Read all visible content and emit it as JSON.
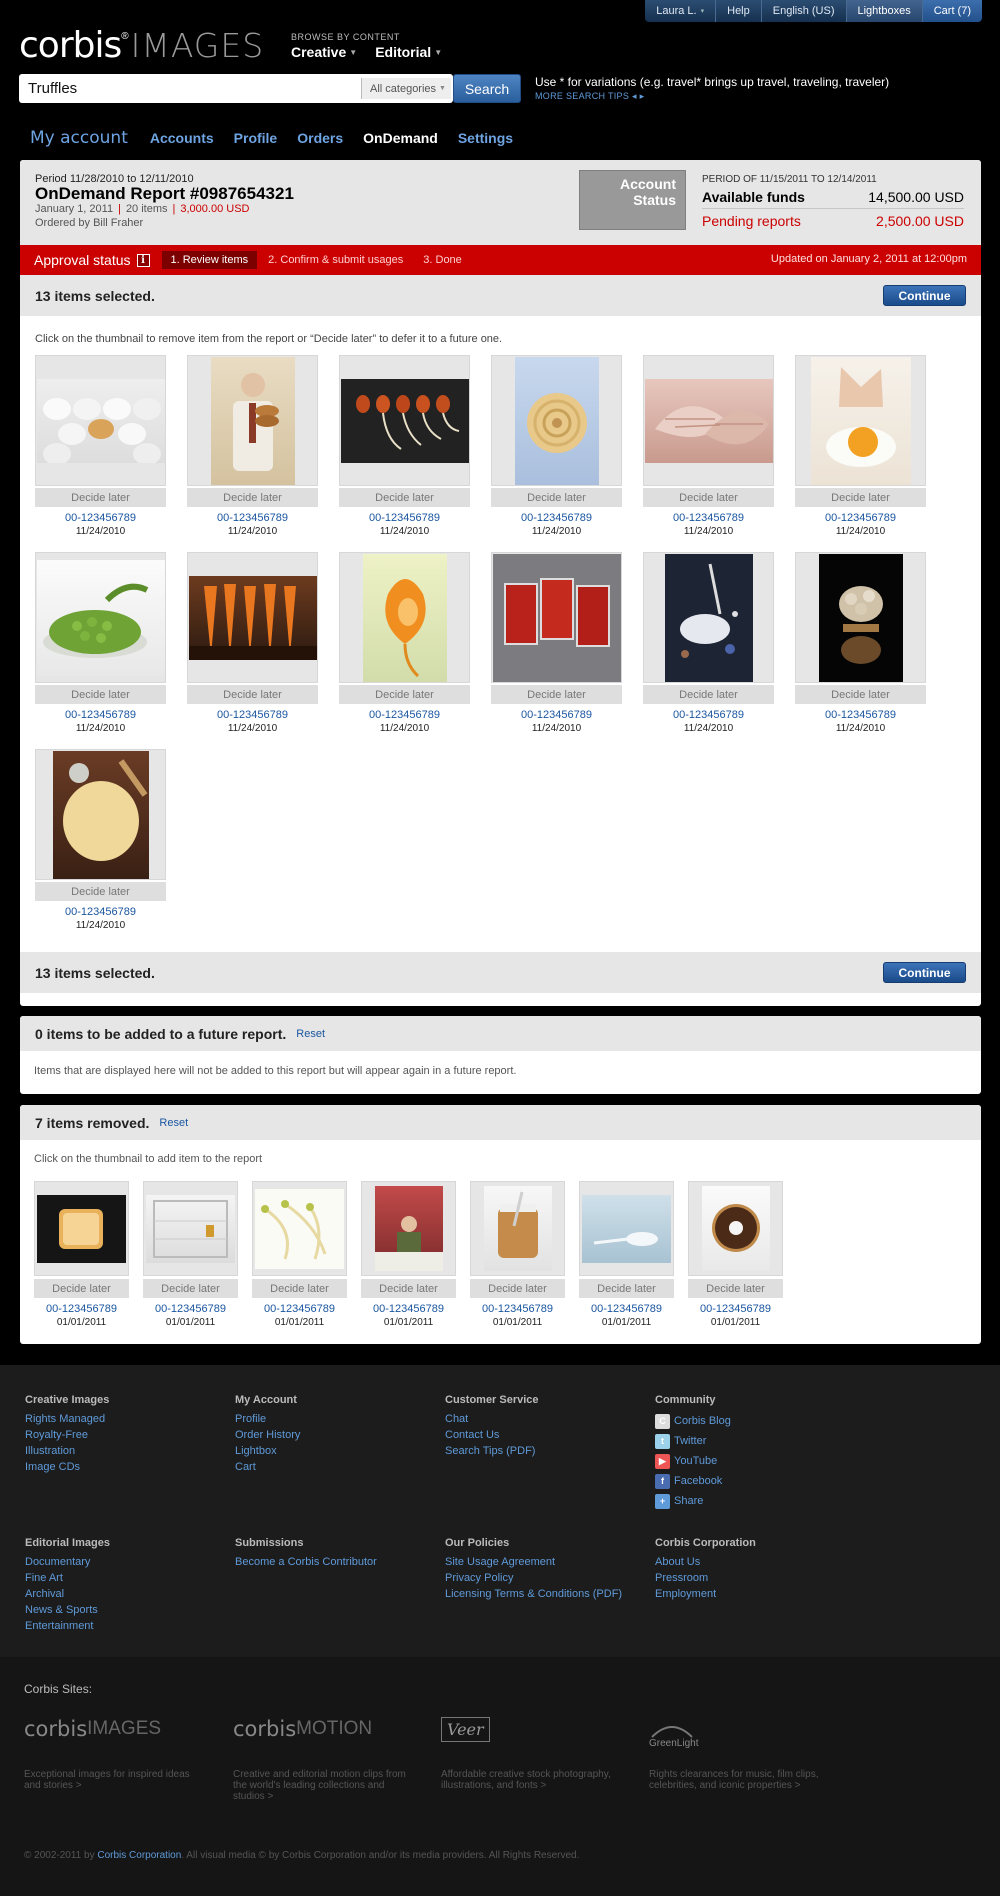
{
  "topbar": {
    "user": "Laura L.",
    "help": "Help",
    "language": "English (US)",
    "lightboxes": "Lightboxes",
    "cart": "Cart (7)"
  },
  "logo": {
    "brand": "corbis",
    "reg": "®",
    "images": "IMAGES"
  },
  "browse": {
    "caption": "BROWSE BY CONTENT",
    "creative": "Creative",
    "editorial": "Editorial"
  },
  "search": {
    "value": "Truffles",
    "category": "All categories",
    "button": "Search",
    "tip": "Use * for variations (e.g. travel* brings up travel, traveling, traveler)",
    "more_tips": "MORE SEARCH TIPS ◂ ▸"
  },
  "subnav": {
    "title": "My account",
    "tabs": [
      "Accounts",
      "Profile",
      "Orders",
      "OnDemand",
      "Settings"
    ]
  },
  "report": {
    "period": "Period 11/28/2010 to 12/11/2010",
    "title": "OnDemand Report #0987654321",
    "date": "January 1, 2011",
    "items": "20 items",
    "amount": "3,000.00 USD",
    "ordered_by": "Ordered by Bill Fraher",
    "account_status": "Account Status",
    "funds_period": "PERIOD OF 11/15/2011 TO 12/14/2011",
    "available_label": "Available funds",
    "available_value": "14,500.00 USD",
    "pending_label": "Pending reports",
    "pending_value": "2,500.00 USD"
  },
  "approval": {
    "label": "Approval status",
    "info": "i",
    "steps": [
      "1. Review items",
      "2. Confirm & submit usages",
      "3. Done"
    ],
    "updated": "Updated on January 2, 2011 at 12:00pm"
  },
  "selection": {
    "count": "13 items selected.",
    "continue": "Continue",
    "instruction": "Click on the thumbnail to remove item from the report or “Decide later” to defer it to a future one."
  },
  "items": [
    {
      "decide": "Decide later",
      "id": "00-123456789",
      "date": "11/24/2010",
      "subject": "eggs"
    },
    {
      "decide": "Decide later",
      "id": "00-123456789",
      "date": "11/24/2010",
      "subject": "man-with-bread"
    },
    {
      "decide": "Decide later",
      "id": "00-123456789",
      "date": "11/24/2010",
      "subject": "sprouts"
    },
    {
      "decide": "Decide later",
      "id": "00-123456789",
      "date": "11/24/2010",
      "subject": "pasta-nest"
    },
    {
      "decide": "Decide later",
      "id": "00-123456789",
      "date": "11/24/2010",
      "subject": "mushrooms"
    },
    {
      "decide": "Decide later",
      "id": "00-123456789",
      "date": "11/24/2010",
      "subject": "egg-yolk"
    },
    {
      "decide": "Decide later",
      "id": "00-123456789",
      "date": "11/24/2010",
      "subject": "peas"
    },
    {
      "decide": "Decide later",
      "id": "00-123456789",
      "date": "11/24/2010",
      "subject": "carrots"
    },
    {
      "decide": "Decide later",
      "id": "00-123456789",
      "date": "11/24/2010",
      "subject": "orange-peel"
    },
    {
      "decide": "Decide later",
      "id": "00-123456789",
      "date": "11/24/2010",
      "subject": "chili-packets"
    },
    {
      "decide": "Decide later",
      "id": "00-123456789",
      "date": "11/24/2010",
      "subject": "salt-crystals"
    },
    {
      "decide": "Decide later",
      "id": "00-123456789",
      "date": "11/24/2010",
      "subject": "mushroom-stack"
    },
    {
      "decide": "Decide later",
      "id": "00-123456789",
      "date": "11/24/2010",
      "subject": "dough"
    }
  ],
  "future": {
    "title": "0 items to be added to a future report.",
    "reset": "Reset",
    "note": "Items that are displayed here will not be added to this report but will appear again in a future report."
  },
  "removed": {
    "title": "7 items removed.",
    "reset": "Reset",
    "instruction": "Click on the thumbnail to add item to the report",
    "items": [
      {
        "decide": "Decide later",
        "id": "00-123456789",
        "date": "01/01/2011",
        "subject": "toast"
      },
      {
        "decide": "Decide later",
        "id": "00-123456789",
        "date": "01/01/2011",
        "subject": "fridge"
      },
      {
        "decide": "Decide later",
        "id": "00-123456789",
        "date": "01/01/2011",
        "subject": "sprouts"
      },
      {
        "decide": "Decide later",
        "id": "00-123456789",
        "date": "01/01/2011",
        "subject": "dining-person"
      },
      {
        "decide": "Decide later",
        "id": "00-123456789",
        "date": "01/01/2011",
        "subject": "peanut-butter"
      },
      {
        "decide": "Decide later",
        "id": "00-123456789",
        "date": "01/01/2011",
        "subject": "spoon"
      },
      {
        "decide": "Decide later",
        "id": "00-123456789",
        "date": "01/01/2011",
        "subject": "donut"
      }
    ]
  },
  "footer": {
    "creative": {
      "title": "Creative Images",
      "links": [
        "Rights Managed",
        "Royalty-Free",
        "Illustration",
        "Image CDs"
      ]
    },
    "account": {
      "title": "My Account",
      "links": [
        "Profile",
        "Order History",
        "Lightbox",
        "Cart"
      ]
    },
    "service": {
      "title": "Customer Service",
      "links": [
        "Chat",
        "Contact Us",
        "Search Tips (PDF)"
      ]
    },
    "community": {
      "title": "Community",
      "links": [
        "Corbis Blog",
        "Twitter",
        "YouTube",
        "Facebook",
        "Share"
      ]
    },
    "editorial": {
      "title": "Editorial Images",
      "links": [
        "Documentary",
        "Fine Art",
        "Archival",
        "News & Sports",
        "Entertainment"
      ]
    },
    "submissions": {
      "title": "Submissions",
      "links": [
        "Become a Corbis Contributor"
      ]
    },
    "policies": {
      "title": "Our Policies",
      "links": [
        "Site Usage Agreement",
        "Privacy Policy",
        "Licensing Terms & Conditions (PDF)"
      ]
    },
    "corporation": {
      "title": "Corbis Corporation",
      "links": [
        "About Us",
        "Pressroom",
        "Employment"
      ]
    },
    "sites_caption": "Corbis Sites:",
    "sites": [
      {
        "logo_a": "corbis",
        "logo_b": "IMAGES",
        "desc": "Exceptional images for inspired ideas and stories  >"
      },
      {
        "logo_a": "corbis",
        "logo_b": "MOTION",
        "desc": "Creative and editorial motion clips from the world's leading collections and studios  >"
      },
      {
        "logo_a": "Veer",
        "logo_b": "",
        "desc": "Affordable creative stock photography, illustrations, and fonts  >"
      },
      {
        "logo_a": "GreenLight",
        "logo_b": "",
        "desc": "Rights clearances for music, film clips, celebrities, and iconic properties  >"
      }
    ],
    "copyright_pre": "© 2002-2011 by ",
    "copyright_link": "Corbis Corporation",
    "copyright_post": ". All visual media © by Corbis Corporation and/or its media providers. All Rights Reserved."
  }
}
